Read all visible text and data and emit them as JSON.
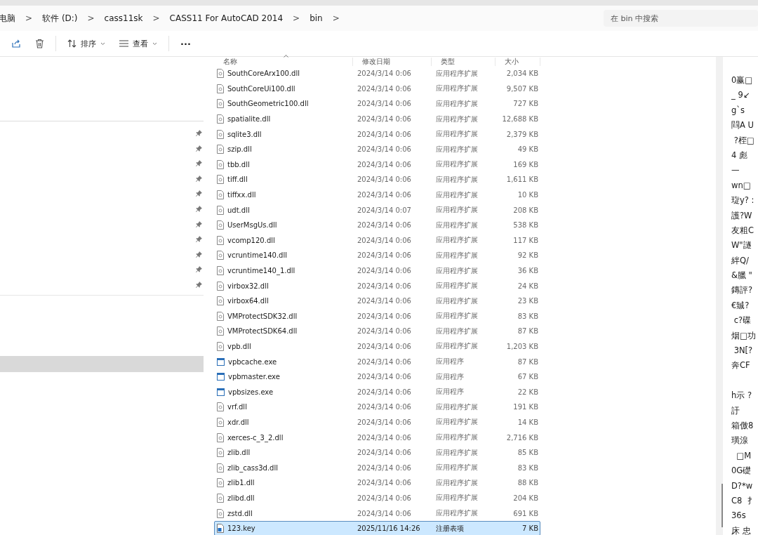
{
  "address_bar": {
    "crumbs": [
      "电脑",
      "软件 (D:)",
      "cass11sk",
      "CASS11 For AutoCAD 2014",
      "bin"
    ],
    "separator": ">"
  },
  "search": {
    "placeholder": "在 bin 中搜索"
  },
  "toolbar": {
    "sort": "排序",
    "view": "查看",
    "more": "···"
  },
  "columns": [
    "名称",
    "修改日期",
    "类型",
    "大小"
  ],
  "files": [
    {
      "name": "SouthCoreArx100.dll",
      "modified": "2024/3/14 0:06",
      "type": "应用程序扩展",
      "size": "2,034 KB",
      "kind": "dll",
      "selected": false
    },
    {
      "name": "SouthCoreUi100.dll",
      "modified": "2024/3/14 0:06",
      "type": "应用程序扩展",
      "size": "9,507 KB",
      "kind": "dll",
      "selected": false
    },
    {
      "name": "SouthGeometric100.dll",
      "modified": "2024/3/14 0:06",
      "type": "应用程序扩展",
      "size": "727 KB",
      "kind": "dll",
      "selected": false
    },
    {
      "name": "spatialite.dll",
      "modified": "2024/3/14 0:06",
      "type": "应用程序扩展",
      "size": "12,688 KB",
      "kind": "dll",
      "selected": false
    },
    {
      "name": "sqlite3.dll",
      "modified": "2024/3/14 0:06",
      "type": "应用程序扩展",
      "size": "2,379 KB",
      "kind": "dll",
      "selected": false
    },
    {
      "name": "szip.dll",
      "modified": "2024/3/14 0:06",
      "type": "应用程序扩展",
      "size": "49 KB",
      "kind": "dll",
      "selected": false
    },
    {
      "name": "tbb.dll",
      "modified": "2024/3/14 0:06",
      "type": "应用程序扩展",
      "size": "169 KB",
      "kind": "dll",
      "selected": false
    },
    {
      "name": "tiff.dll",
      "modified": "2024/3/14 0:06",
      "type": "应用程序扩展",
      "size": "1,611 KB",
      "kind": "dll",
      "selected": false
    },
    {
      "name": "tiffxx.dll",
      "modified": "2024/3/14 0:06",
      "type": "应用程序扩展",
      "size": "10 KB",
      "kind": "dll",
      "selected": false
    },
    {
      "name": "udt.dll",
      "modified": "2024/3/14 0:07",
      "type": "应用程序扩展",
      "size": "208 KB",
      "kind": "dll",
      "selected": false
    },
    {
      "name": "UserMsgUs.dll",
      "modified": "2024/3/14 0:06",
      "type": "应用程序扩展",
      "size": "538 KB",
      "kind": "dll",
      "selected": false
    },
    {
      "name": "vcomp120.dll",
      "modified": "2024/3/14 0:06",
      "type": "应用程序扩展",
      "size": "117 KB",
      "kind": "dll",
      "selected": false
    },
    {
      "name": "vcruntime140.dll",
      "modified": "2024/3/14 0:06",
      "type": "应用程序扩展",
      "size": "92 KB",
      "kind": "dll",
      "selected": false
    },
    {
      "name": "vcruntime140_1.dll",
      "modified": "2024/3/14 0:06",
      "type": "应用程序扩展",
      "size": "36 KB",
      "kind": "dll",
      "selected": false
    },
    {
      "name": "virbox32.dll",
      "modified": "2024/3/14 0:06",
      "type": "应用程序扩展",
      "size": "24 KB",
      "kind": "dll",
      "selected": false
    },
    {
      "name": "virbox64.dll",
      "modified": "2024/3/14 0:06",
      "type": "应用程序扩展",
      "size": "23 KB",
      "kind": "dll",
      "selected": false
    },
    {
      "name": "VMProtectSDK32.dll",
      "modified": "2024/3/14 0:06",
      "type": "应用程序扩展",
      "size": "83 KB",
      "kind": "dll",
      "selected": false
    },
    {
      "name": "VMProtectSDK64.dll",
      "modified": "2024/3/14 0:06",
      "type": "应用程序扩展",
      "size": "87 KB",
      "kind": "dll",
      "selected": false
    },
    {
      "name": "vpb.dll",
      "modified": "2024/3/14 0:06",
      "type": "应用程序扩展",
      "size": "1,203 KB",
      "kind": "dll",
      "selected": false
    },
    {
      "name": "vpbcache.exe",
      "modified": "2024/3/14 0:06",
      "type": "应用程序",
      "size": "87 KB",
      "kind": "exe",
      "selected": false
    },
    {
      "name": "vpbmaster.exe",
      "modified": "2024/3/14 0:06",
      "type": "应用程序",
      "size": "67 KB",
      "kind": "exe",
      "selected": false
    },
    {
      "name": "vpbsizes.exe",
      "modified": "2024/3/14 0:06",
      "type": "应用程序",
      "size": "22 KB",
      "kind": "exe",
      "selected": false
    },
    {
      "name": "vrf.dll",
      "modified": "2024/3/14 0:06",
      "type": "应用程序扩展",
      "size": "191 KB",
      "kind": "dll",
      "selected": false
    },
    {
      "name": "xdr.dll",
      "modified": "2024/3/14 0:06",
      "type": "应用程序扩展",
      "size": "14 KB",
      "kind": "dll",
      "selected": false
    },
    {
      "name": "xerces-c_3_2.dll",
      "modified": "2024/3/14 0:06",
      "type": "应用程序扩展",
      "size": "2,716 KB",
      "kind": "dll",
      "selected": false
    },
    {
      "name": "zlib.dll",
      "modified": "2024/3/14 0:06",
      "type": "应用程序扩展",
      "size": "85 KB",
      "kind": "dll",
      "selected": false
    },
    {
      "name": "zlib_cass3d.dll",
      "modified": "2024/3/14 0:06",
      "type": "应用程序扩展",
      "size": "83 KB",
      "kind": "dll",
      "selected": false
    },
    {
      "name": "zlib1.dll",
      "modified": "2024/3/14 0:06",
      "type": "应用程序扩展",
      "size": "88 KB",
      "kind": "dll",
      "selected": false
    },
    {
      "name": "zlibd.dll",
      "modified": "2024/3/14 0:06",
      "type": "应用程序扩展",
      "size": "204 KB",
      "kind": "dll",
      "selected": false
    },
    {
      "name": "zstd.dll",
      "modified": "2024/3/14 0:06",
      "type": "应用程序扩展",
      "size": "691 KB",
      "kind": "dll",
      "selected": false
    },
    {
      "name": "123.key",
      "modified": "2025/11/16 14:26",
      "type": "注册表项",
      "size": "7 KB",
      "kind": "key",
      "selected": true
    }
  ],
  "editor_lines": [
    "0赢□",
    "_ 9↙",
    "g`s",
    "閰A U",
    " ?桎□",
    "4 彪",
    "—",
    "wn□",
    "琁y? :",
    "護?W",
    "友粗C",
    "W\"譢",
    "絆Q/",
    "&臘 \"",
    "鏄評?",
    "€臹?",
    " c?碟",
    "烟□功",
    " 3N[?",
    "奔CF",
    {
      "text": "h示 ?",
      "gap_before": true
    },
    "訏",
    "箱儌8",
    "璜湶",
    "  □M",
    "0G礎",
    "D?*w",
    "C8  扌",
    "36s",
    "床 忠"
  ]
}
